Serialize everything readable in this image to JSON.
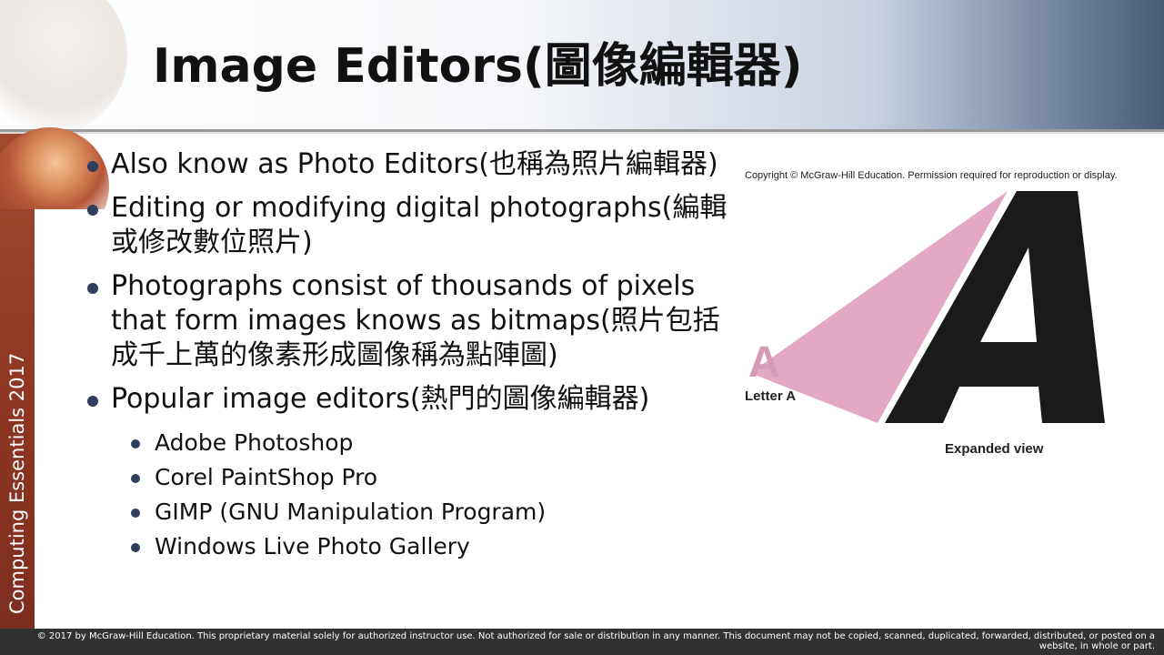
{
  "slide": {
    "title": "Image Editors(圖像編輯器)",
    "sidebar_text": "Computing Essentials 2017",
    "bullets": [
      "Also know as Photo Editors(也稱為照片編輯器)",
      "Editing or modifying digital photographs(編輯或修改數位照片)",
      "Photographs consist of thousands of pixels that form images knows as bitmaps(照片包括成千上萬的像素形成圖像稱為點陣圖)",
      "Popular image editors(熱門的圖像編輯器)"
    ],
    "sub_bullets": [
      "Adobe Photoshop",
      "Corel PaintShop Pro",
      "GIMP (GNU Manipulation Program)",
      "Windows Live Photo Gallery"
    ]
  },
  "figure": {
    "copyright": "Copyright © McGraw-Hill Education. Permission required for reproduction or display.",
    "small_letter": "A",
    "letter_label": "Letter A",
    "expanded_label": "Expanded view",
    "colors": {
      "wedge": "#e3a8c3",
      "letter": "#1a1a1a",
      "small_letter": "#d49ab6"
    }
  },
  "footer": {
    "text": "© 2017 by McGraw-Hill Education. This proprietary material solely for authorized instructor use. Not authorized for sale or distribution in any manner. This document may not be copied, scanned, duplicated, forwarded, distributed, or posted on a website, in whole or part."
  }
}
